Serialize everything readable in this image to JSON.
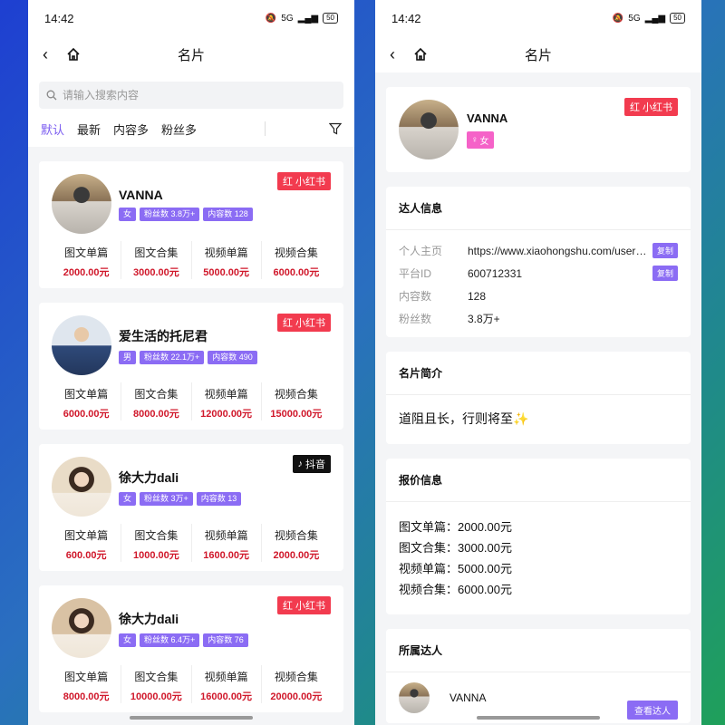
{
  "status_time": "14:42",
  "status_network": "5G",
  "status_battery": "50",
  "nav_title": "名片",
  "search_placeholder": "请输入搜索内容",
  "sort_tabs": [
    "默认",
    "最新",
    "内容多",
    "粉丝多"
  ],
  "price_labels": [
    "图文单篇",
    "图文合集",
    "视频单篇",
    "视频合集"
  ],
  "cards": [
    {
      "name": "VANNA",
      "gender": "女",
      "followers": "粉丝数 3.8万+",
      "contents": "内容数 128",
      "platform": "小红书",
      "platform_type": "xhs",
      "prices": [
        "2000.00元",
        "3000.00元",
        "5000.00元",
        "6000.00元"
      ]
    },
    {
      "name": "爱生活的托尼君",
      "gender": "男",
      "followers": "粉丝数 22.1万+",
      "contents": "内容数 490",
      "platform": "小红书",
      "platform_type": "xhs",
      "prices": [
        "6000.00元",
        "8000.00元",
        "12000.00元",
        "15000.00元"
      ]
    },
    {
      "name": "徐大力dali",
      "gender": "女",
      "followers": "粉丝数 3万+",
      "contents": "内容数 13",
      "platform": "抖音",
      "platform_type": "dy",
      "prices": [
        "600.00元",
        "1000.00元",
        "1600.00元",
        "2000.00元"
      ]
    },
    {
      "name": "徐大力dali",
      "gender": "女",
      "followers": "粉丝数 6.4万+",
      "contents": "内容数 76",
      "platform": "小红书",
      "platform_type": "xhs",
      "prices": [
        "8000.00元",
        "10000.00元",
        "16000.00元",
        "20000.00元"
      ]
    }
  ],
  "detail": {
    "name": "VANNA",
    "gender": "女",
    "platform": "小红书",
    "talent_info_title": "达人信息",
    "info_rows": [
      {
        "key": "个人主页",
        "value": "https://www.xiaohongshu.com/user/profile",
        "copy": "复制"
      },
      {
        "key": "平台ID",
        "value": "600712331",
        "copy": "复制"
      },
      {
        "key": "内容数",
        "value": "128"
      },
      {
        "key": "粉丝数",
        "value": "3.8万+"
      }
    ],
    "intro_title": "名片简介",
    "intro_text": "道阻且长，行则将至✨",
    "quote_title": "报价信息",
    "quote_lines": [
      "图文单篇：2000.00元",
      "图文合集：3000.00元",
      "视频单篇：5000.00元",
      "视频合集：6000.00元"
    ],
    "owner_title": "所属达人",
    "owner_name": "VANNA",
    "view_button": "查看达人"
  },
  "colors": {
    "accent": "#7b5cf0",
    "tag_purple": "#8b6cf4",
    "xiaohongshu_red": "#f23b4f",
    "price_red": "#d0172a",
    "gender_pink": "#f562c8"
  },
  "icons": [
    "back-arrow-icon",
    "home-icon",
    "search-icon",
    "filter-icon",
    "mute-bell-icon",
    "signal-icon",
    "battery-icon",
    "xiaohongshu-logo-icon",
    "douyin-logo-icon",
    "female-icon"
  ]
}
